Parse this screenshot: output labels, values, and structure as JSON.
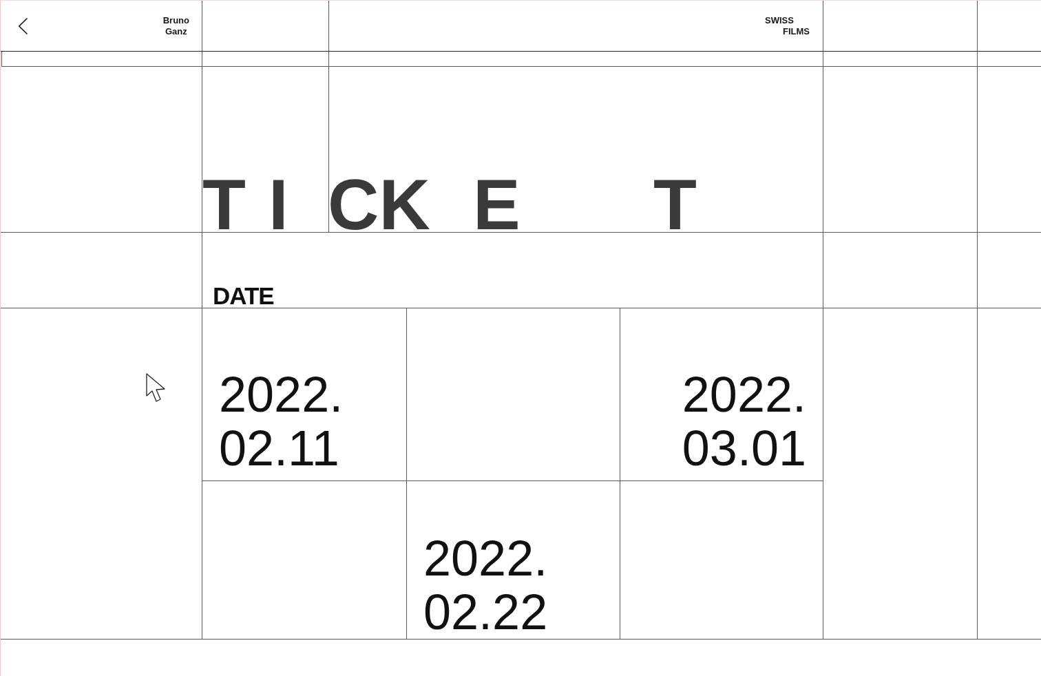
{
  "header": {
    "name": {
      "lines": [
        "Bruno",
        "Ganz"
      ]
    },
    "logo": {
      "lines": [
        "SWISS",
        "FILMS"
      ]
    }
  },
  "title": {
    "parts": [
      "T",
      "I",
      "CK",
      "E",
      "T"
    ]
  },
  "date_label": "DATE",
  "dates": [
    {
      "lines": [
        "2022.",
        "02.11"
      ]
    },
    {
      "lines": [
        "2022.",
        "03.01"
      ]
    },
    {
      "lines": [
        "2022.",
        "02.22"
      ]
    }
  ]
}
